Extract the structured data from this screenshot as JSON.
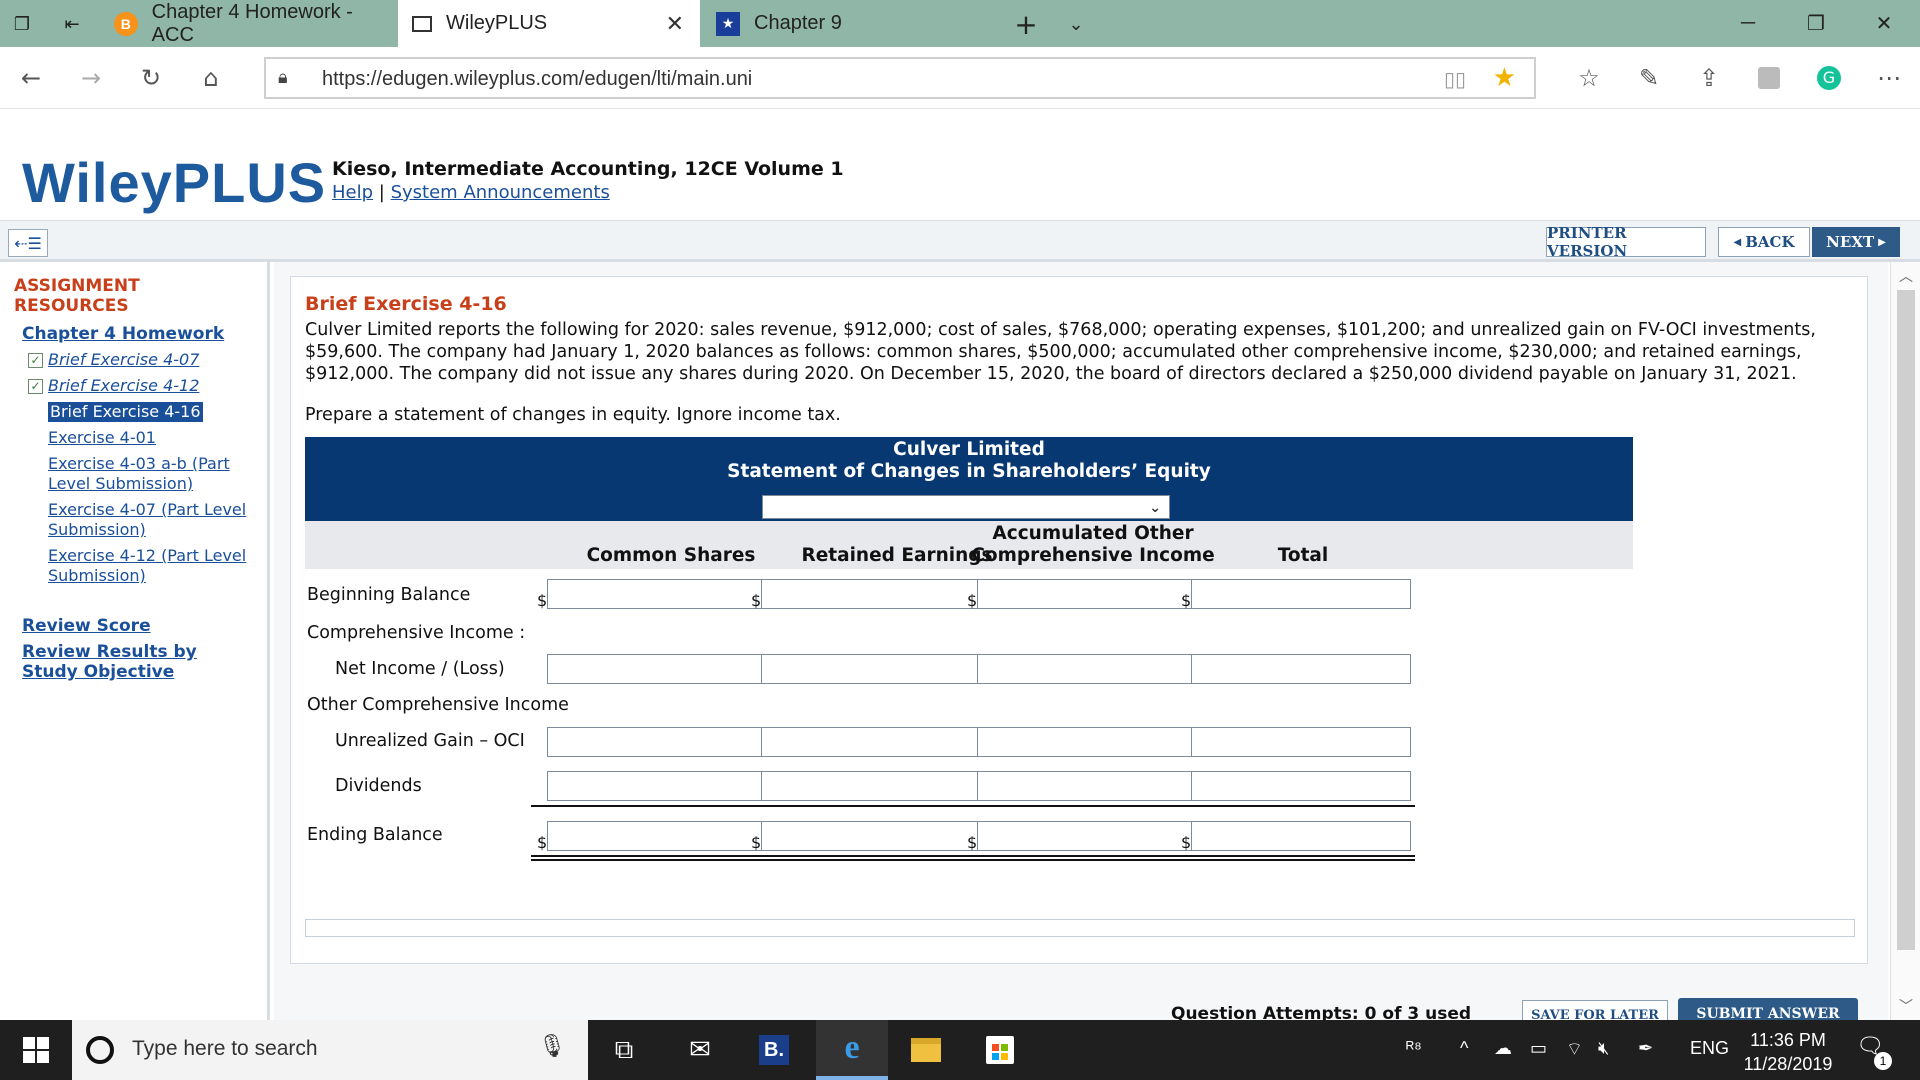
{
  "browser": {
    "tabs": [
      {
        "label": "Chapter 4 Homework - ACC",
        "icon": "bitcoin-icon"
      },
      {
        "label": "WileyPLUS",
        "icon": "page-icon"
      },
      {
        "label": "Chapter 9",
        "icon": "shield-star-icon"
      }
    ],
    "url": "https://edugen.wileyplus.com/edugen/lti/main.uni"
  },
  "header": {
    "logo": "WileyPLUS",
    "course": "Kieso, Intermediate Accounting, 12CE Volume 1",
    "help": "Help",
    "separator": "|",
    "announcements": "System Announcements"
  },
  "toolbar": {
    "printer": "PRINTER VERSION",
    "back": "BACK",
    "next": "NEXT"
  },
  "sidebar": {
    "title": "ASSIGNMENT RESOURCES",
    "chapter": "Chapter 4 Homework",
    "items": [
      {
        "label": "Brief Exercise 4-07",
        "done": true
      },
      {
        "label": "Brief Exercise 4-12",
        "done": true
      },
      {
        "label": "Brief Exercise 4-16",
        "current": true
      },
      {
        "label": "Exercise 4-01"
      },
      {
        "label": "Exercise 4-03 a-b (Part Level Submission)"
      },
      {
        "label": "Exercise 4-07 (Part Level Submission)"
      },
      {
        "label": "Exercise 4-12 (Part Level Submission)"
      }
    ],
    "review_score": "Review Score",
    "review_results": "Review Results by Study Objective"
  },
  "exercise": {
    "title": "Brief Exercise 4-16",
    "text": "Culver Limited reports the following for 2020: sales revenue, $912,000; cost of sales, $768,000; operating expenses, $101,200; and unrealized gain on FV-OCI investments, $59,600. The company had January 1, 2020 balances as follows: common shares, $500,000; accumulated other comprehensive income, $230,000; and retained earnings, $912,000. The company did not issue any shares during 2020. On December 15, 2020, the board of directors declared a $250,000 dividend payable on January 31, 2021.",
    "instruction": "Prepare a statement of changes in equity. Ignore income tax."
  },
  "statement": {
    "company": "Culver Limited",
    "title": "Statement of Changes in Shareholders’ Equity",
    "period_value": "",
    "columns": {
      "common": "Common Shares",
      "retained": "Retained Earnings",
      "aoci_line1": "Accumulated Other",
      "aoci_line2": "Comprehensive Income",
      "total": "Total"
    },
    "rows": {
      "beginning": "Beginning Balance",
      "comprehensive": "Comprehensive Income :",
      "net_income": "Net Income / (Loss)",
      "oci": "Other Comprehensive Income",
      "unrealized": "Unrealized Gain – OCI",
      "dividends": "Dividends",
      "ending": "Ending Balance"
    },
    "currency": "$"
  },
  "footer": {
    "attempts": "Question Attempts: 0 of 3 used",
    "save": "SAVE FOR LATER",
    "submit": "SUBMIT ANSWER"
  },
  "taskbar": {
    "search_placeholder": "Type here to search",
    "language": "ENG",
    "time": "11:36 PM",
    "date": "11/28/2019",
    "notification_count": "1"
  }
}
